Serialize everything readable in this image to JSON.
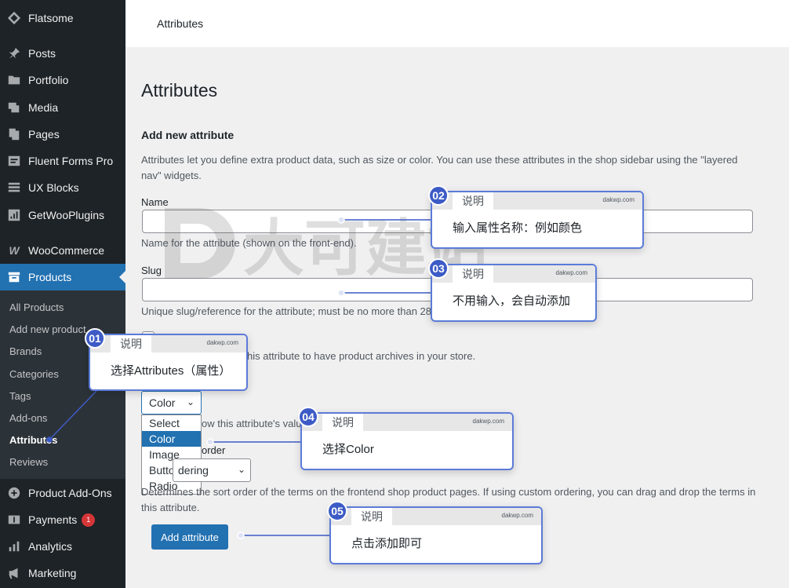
{
  "sidebar": {
    "items": [
      {
        "label": "Flatsome",
        "icon": "diamond-icon"
      },
      {
        "label": "Posts",
        "icon": "pin-icon"
      },
      {
        "label": "Portfolio",
        "icon": "folder-icon"
      },
      {
        "label": "Media",
        "icon": "media-icon"
      },
      {
        "label": "Pages",
        "icon": "pages-icon"
      },
      {
        "label": "Fluent Forms Pro",
        "icon": "form-icon"
      },
      {
        "label": "UX Blocks",
        "icon": "grid-icon"
      },
      {
        "label": "GetWooPlugins",
        "icon": "plugin-icon"
      },
      {
        "label": "WooCommerce",
        "icon": "woo-icon"
      },
      {
        "label": "Products",
        "icon": "archive-icon"
      },
      {
        "label": "Product Add-Ons",
        "icon": "plus-circle-icon"
      },
      {
        "label": "Payments",
        "icon": "dollar-icon",
        "badge": "1"
      },
      {
        "label": "Analytics",
        "icon": "bar-chart-icon"
      },
      {
        "label": "Marketing",
        "icon": "megaphone-icon"
      }
    ],
    "submenu": [
      "All Products",
      "Add new product",
      "Brands",
      "Categories",
      "Tags",
      "Add-ons",
      "Attributes",
      "Reviews"
    ]
  },
  "topbar": {
    "breadcrumb": "Attributes"
  },
  "main": {
    "title": "Attributes",
    "section_title": "Add new attribute",
    "intro": "Attributes let you define extra product data, such as size or color. You can use these attributes in the shop sidebar using the \"layered nav\" widgets.",
    "name_label": "Name",
    "name_help": "Name for the attribute (shown on the front-end).",
    "slug_label": "Slug",
    "slug_help": "Unique slug/reference for the attribute; must be no more than 28",
    "archives_help": "his attribute to have product archives in your store.",
    "type_value": "Color",
    "type_options": [
      "Select",
      "Color",
      "Image",
      "Button",
      "Radio"
    ],
    "type_help": "ow this attribute's valu",
    "order_label": "order",
    "order_value": "dering",
    "order_help": "Determines the sort order of the terms on the frontend shop product pages. If using custom ordering, you can drag and drop the terms in this attribute.",
    "submit_label": "Add attribute"
  },
  "callouts": [
    {
      "num": "01",
      "tag": "说明",
      "site": "dakwp.com",
      "text": "选择Attributes（属性）"
    },
    {
      "num": "02",
      "tag": "说明",
      "site": "dakwp.com",
      "text": "输入属性名称：例如颜色"
    },
    {
      "num": "03",
      "tag": "说明",
      "site": "dakwp.com",
      "text": "不用输入，会自动添加"
    },
    {
      "num": "04",
      "tag": "说明",
      "site": "dakwp.com",
      "text": "选择Color"
    },
    {
      "num": "05",
      "tag": "说明",
      "site": "dakwp.com",
      "text": "点击添加即可"
    }
  ],
  "watermark": {
    "text": "大可建站",
    "color": "#555555"
  },
  "colors": {
    "sidebar": "#1d2327",
    "accent": "#2271b1",
    "callout_border": "#5b7bd8",
    "badge": "#d63638"
  }
}
